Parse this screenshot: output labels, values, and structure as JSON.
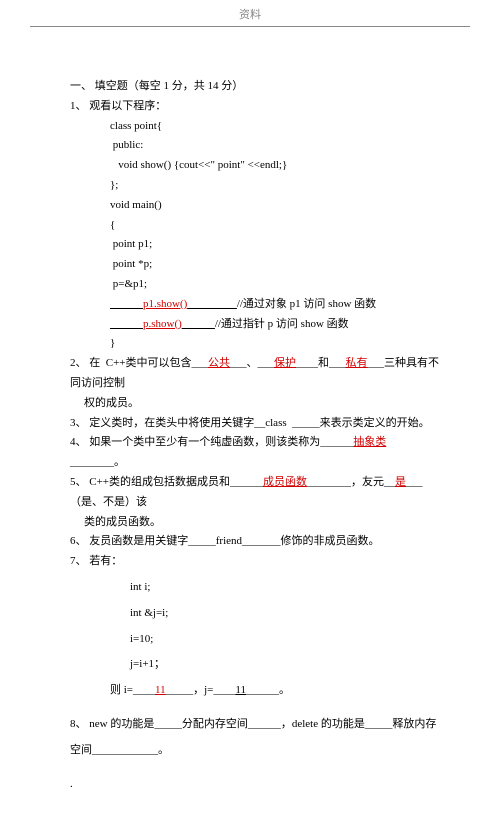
{
  "header": {
    "title": "资料"
  },
  "section": {
    "title": "一、 填空题（每空 1 分，共 14 分）"
  },
  "q1": {
    "label": "1、 观看以下程序：",
    "code": [
      "class point{",
      " public:",
      "   void show() {cout<<\" point\" <<endl;}",
      "};",
      "void main()",
      "{",
      " point p1;",
      " point *p;",
      " p=&p1;"
    ],
    "blank_prefix": "______",
    "ans1": "p1.show()",
    "suffix1_u": "_________",
    "suffix1_txt": "//通过对象 p1 访问 show 函数",
    "ans2": "p.show()",
    "suffix2_u": "______",
    "suffix2_txt": "//通过指针 p 访问 show 函数",
    "close": "}"
  },
  "q2": {
    "pre": "2、 在  C++类中可以包含___",
    "a1": "公共",
    "mid1": "___、___",
    "a2": "保护",
    "mid2": "____和___",
    "a3": "私有",
    "post": "___三种具有不同访问控制",
    "line2": "权的成员。"
  },
  "q3": {
    "text": "3、 定义类时，在类头中将使用关键字__class  _____来表示类定义的开始。"
  },
  "q4": {
    "pre": "4、 如果一个类中至少有一个纯虚函数，则该类称为______",
    "a": "抽象类",
    "post": "________。"
  },
  "q5": {
    "pre": "5、 C++类的组成包括数据成员和______",
    "a1": "成员函数",
    "mid": "________，友元__",
    "a2": "是",
    "post": "___（是、不是）该",
    "line2": "类的成员函数。"
  },
  "q6": {
    "text": "6、 友员函数是用关键字_____friend_______修饰的非成员函数。"
  },
  "q7": {
    "label": "7、 若有：",
    "c1": "int i;",
    "c2": "int &j=i;",
    "c3": "i=10;",
    "c4": "j=i+1；",
    "res_pre": "则 i=____",
    "a1": "11",
    "res_mid": "_____，j=____",
    "a2": "11",
    "res_post": "______。"
  },
  "q8": {
    "l1": "8、 new 的功能是_____分配内存空间______，delete 的功能是_____释放内存",
    "l2": "空间____________。"
  },
  "footer_dot": "."
}
